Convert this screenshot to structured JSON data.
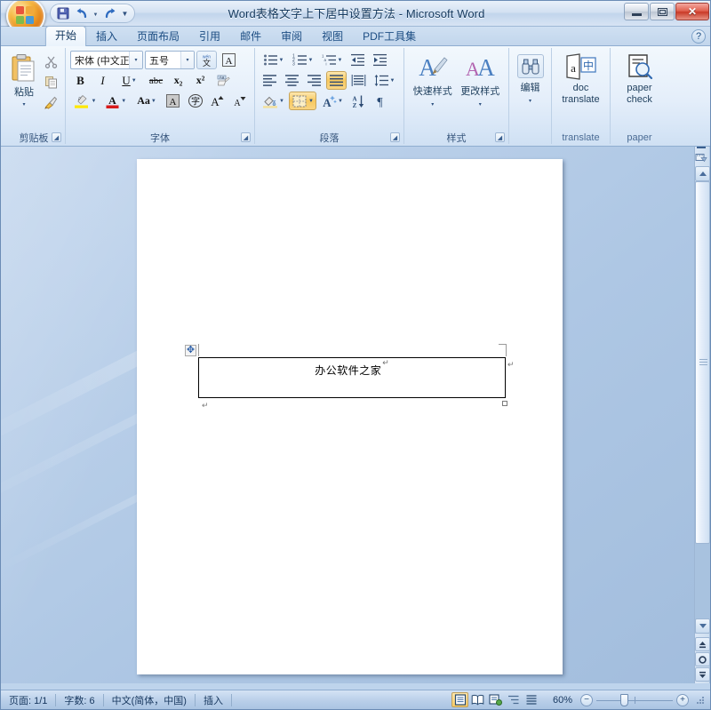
{
  "window": {
    "title": "Word表格文字上下居中设置方法 - Microsoft Word",
    "minimize_label": "最小化",
    "restore_label": "还原",
    "close_label": "关闭",
    "close_glyph": "✕"
  },
  "quick_access": {
    "office_button": "Office 按钮",
    "buttons": [
      {
        "name": "save",
        "label": "保存",
        "glyph": "💾"
      },
      {
        "name": "undo",
        "label": "撤消",
        "glyph": "↺"
      },
      {
        "name": "redo",
        "label": "恢复",
        "glyph": "↻"
      }
    ],
    "customize_glyph": "▾"
  },
  "tabs": [
    {
      "label": "开始",
      "active": true
    },
    {
      "label": "插入",
      "active": false
    },
    {
      "label": "页面布局",
      "active": false
    },
    {
      "label": "引用",
      "active": false
    },
    {
      "label": "邮件",
      "active": false
    },
    {
      "label": "审阅",
      "active": false
    },
    {
      "label": "视图",
      "active": false
    },
    {
      "label": "PDF工具集",
      "active": false
    }
  ],
  "help_button": "?",
  "ribbon": {
    "clipboard": {
      "group_label": "剪贴板",
      "paste_label": "粘贴",
      "paste_arrow": "▾",
      "cut_label": "剪切",
      "copy_label": "复制",
      "format_painter_label": "格式刷",
      "launcher": "◢"
    },
    "font": {
      "group_label": "字体",
      "font_name": "宋体 (中文正文)",
      "font_size": "五号",
      "arrow": "▾",
      "phonetic_guide": "拼音指南",
      "char_border": "字符边框",
      "bold": "B",
      "italic": "I",
      "underline": "U",
      "strikethrough": "abc",
      "subscript": "x₂",
      "superscript": "x²",
      "clear_format": "清除格式",
      "highlight": "ab",
      "font_color": "A",
      "change_case": "Aa",
      "shading": "A",
      "enclose_char": "字",
      "grow_font": "A",
      "shrink_font": "A",
      "launcher": "◢"
    },
    "paragraph": {
      "group_label": "段落",
      "bullets": "项目符号",
      "numbering": "编号",
      "multilevel": "多级列表",
      "decrease_indent": "减少缩进量",
      "increase_indent": "增加缩进量",
      "align_left": "左对齐",
      "align_center": "居中",
      "align_right": "右对齐",
      "align_justify": "两端对齐",
      "align_distributed": "分散对齐",
      "line_spacing": "行距",
      "shading": "底纹",
      "borders": "边框",
      "text_effects": "文本效果",
      "sort": "排序",
      "show_marks": "显示编辑标记",
      "arrow": "▾",
      "launcher": "◢"
    },
    "styles": {
      "group_label": "样式",
      "quick_styles": "快速样式",
      "change_styles": "更改样式",
      "arrow": "▾",
      "launcher": "◢"
    },
    "editing": {
      "group_label": "编辑",
      "edit_label": "编辑",
      "arrow": "▾"
    },
    "translate": {
      "group_label": "translate",
      "doc_translate_line1": "doc",
      "doc_translate_line2": "translate"
    },
    "paper": {
      "group_label": "paper",
      "paper_check_line1": "paper",
      "paper_check_line2": "check"
    }
  },
  "document": {
    "table": {
      "move_handle": "✥",
      "cell_text": "办公软件之家",
      "paragraph_mark": "↵"
    },
    "after_table_mark": "↵"
  },
  "scrollbar": {
    "ruler_toggle": "标尺",
    "scroll_up": "向上滚动",
    "scroll_down": "向下滚动",
    "browse_prev": "前一页",
    "browse_select": "选择浏览对象",
    "browse_next": "后一页",
    "prev_glyph": "▲",
    "select_glyph": "●",
    "next_glyph": "▼"
  },
  "status": {
    "page": "页面: 1/1",
    "words": "字数: 6",
    "language": "中文(简体，中国)",
    "insert_mode": "插入",
    "zoom_level": "60%",
    "zoom_out": "−",
    "zoom_in": "+",
    "views": [
      {
        "name": "print-layout",
        "label": "页面视图",
        "active": true
      },
      {
        "name": "full-screen-reading",
        "label": "阅读版式视图",
        "active": false
      },
      {
        "name": "web-layout",
        "label": "Web 版式视图",
        "active": false
      },
      {
        "name": "outline",
        "label": "大纲视图",
        "active": false
      },
      {
        "name": "draft",
        "label": "普通视图",
        "active": false
      }
    ]
  },
  "colors": {
    "accent": "#1b4c82",
    "workspace": "#aec7e4",
    "highlight": "#f8c95f",
    "close": "#c93a27"
  }
}
